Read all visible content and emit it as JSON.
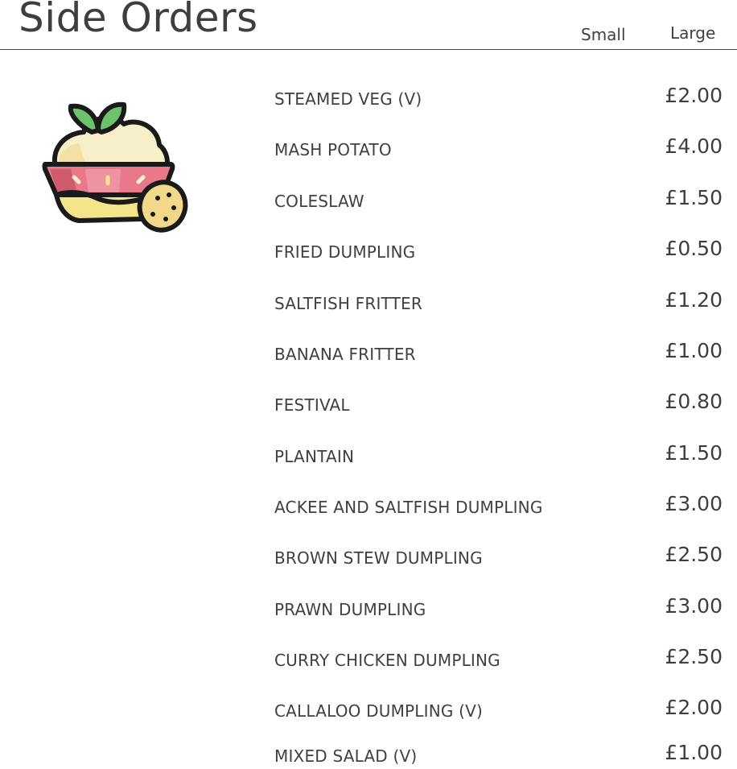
{
  "header": {
    "title": "Side Orders",
    "col_small": "Small",
    "col_large": "Large"
  },
  "illustration": {
    "icon": "mashed-potato-bowl-icon",
    "colors": {
      "outline": "#1a1a1a",
      "leaf": "#6cc36c",
      "mash": "#f7efc9",
      "bowl": "#e8788a",
      "bowl_shadow": "#d05a6e",
      "bowl_base": "#f4e58a",
      "potato": "#f2d98a"
    }
  },
  "items": [
    {
      "name": "STEAMED VEG (V)",
      "price": "£2.00"
    },
    {
      "name": "MASH POTATO",
      "price": "£4.00"
    },
    {
      "name": "COLESLAW",
      "price": "£1.50"
    },
    {
      "name": "FRIED DUMPLING",
      "price": "£0.50"
    },
    {
      "name": "SALTFISH FRITTER",
      "price": "£1.20"
    },
    {
      "name": "BANANA FRITTER",
      "price": "£1.00"
    },
    {
      "name": "FESTIVAL",
      "price": "£0.80"
    },
    {
      "name": "PLANTAIN",
      "price": "£1.50"
    },
    {
      "name": "ACKEE AND SALTFISH DUMPLING",
      "price": "£3.00"
    },
    {
      "name": "BROWN STEW DUMPLING",
      "price": "£2.50"
    },
    {
      "name": "PRAWN DUMPLING",
      "price": "£3.00"
    },
    {
      "name": "CURRY CHICKEN DUMPLING",
      "price": "£2.50"
    },
    {
      "name": "CALLALOO DUMPLING (V)",
      "price": "£2.00"
    },
    {
      "name": "MIXED SALAD (V)",
      "price": "£1.00"
    }
  ]
}
